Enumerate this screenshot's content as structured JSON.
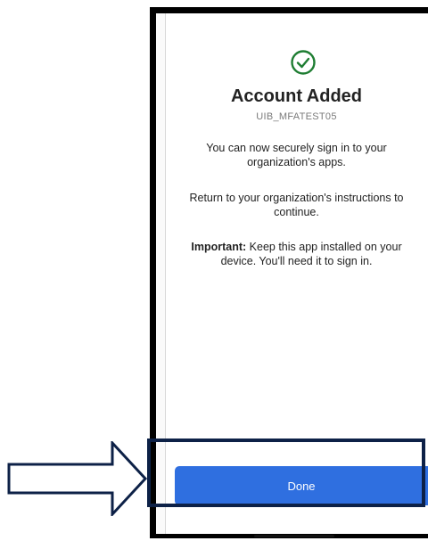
{
  "screen": {
    "icon": "check-circle-icon",
    "title": "Account Added",
    "account_name": "UIB_MFATEST05",
    "message_1": "You can now securely sign in to your organization's apps.",
    "message_2": "Return to your organization's instructions to continue.",
    "important_label": "Important:",
    "important_text": " Keep this app installed on your device. You'll need it to sign in.",
    "done_label": "Done"
  },
  "annotation": {
    "arrow": "right-arrow-icon",
    "highlight": "highlight-box"
  },
  "colors": {
    "success_green": "#1e7d32",
    "button_blue": "#2f6fe0",
    "highlight_navy": "#0d2147"
  }
}
